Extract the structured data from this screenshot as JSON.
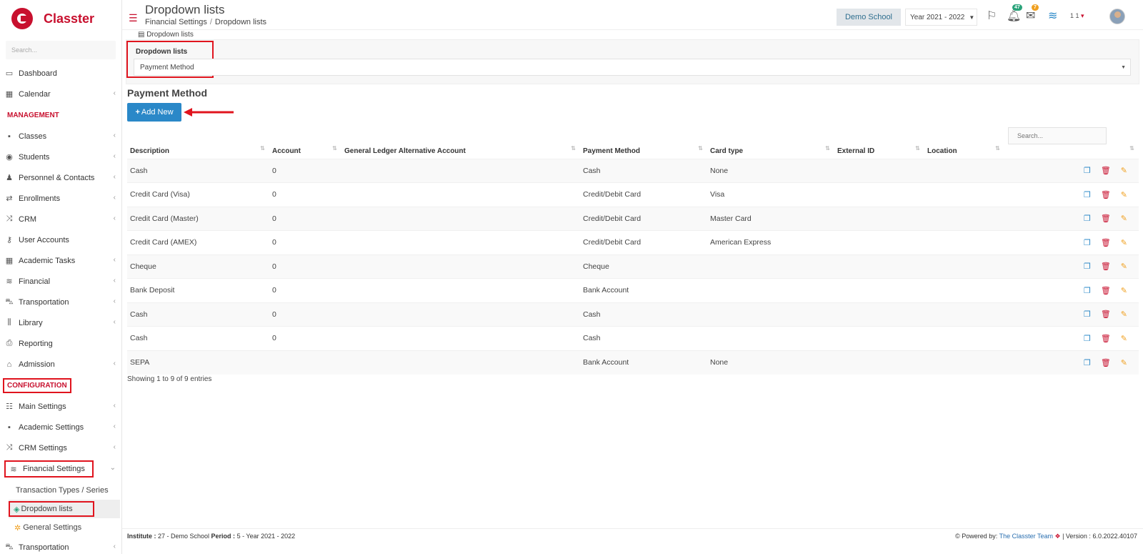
{
  "app": {
    "brand": "Classter",
    "brand_color": "#c8102e",
    "accent": "#2a88c8"
  },
  "sidebar": {
    "search_placeholder": "Search...",
    "items_top": [
      {
        "label": "Dashboard",
        "icon": "laptop-icon"
      },
      {
        "label": "Calendar",
        "icon": "calendar-icon"
      }
    ],
    "management_header": "MANAGEMENT",
    "management": [
      {
        "label": "Classes",
        "icon": "classes-icon"
      },
      {
        "label": "Students",
        "icon": "students-icon"
      },
      {
        "label": "Personnel & Contacts",
        "icon": "person-icon"
      },
      {
        "label": "Enrollments",
        "icon": "exchange-icon"
      },
      {
        "label": "CRM",
        "icon": "shuffle-icon"
      },
      {
        "label": "User Accounts",
        "icon": "key-icon"
      },
      {
        "label": "Academic Tasks",
        "icon": "tasks-icon"
      },
      {
        "label": "Financial",
        "icon": "coins-icon"
      },
      {
        "label": "Transportation",
        "icon": "bus-icon"
      },
      {
        "label": "Library",
        "icon": "books-icon"
      },
      {
        "label": "Reporting",
        "icon": "print-icon"
      },
      {
        "label": "Admission",
        "icon": "institution-icon"
      }
    ],
    "configuration_header": "CONFIGURATION",
    "configuration": [
      {
        "label": "Main Settings",
        "icon": "sliders-icon"
      },
      {
        "label": "Academic Settings",
        "icon": "classes-icon"
      },
      {
        "label": "CRM Settings",
        "icon": "shuffle-icon"
      }
    ],
    "financial_settings": "Financial Settings",
    "sub": {
      "transaction": "Transaction Types / Series",
      "dropdown": "Dropdown lists",
      "general": "General Settings"
    },
    "transport_bottom": "Transportation"
  },
  "header": {
    "title": "Dropdown lists",
    "breadcrumb": [
      "Financial Settings",
      "Dropdown lists"
    ],
    "school": "Demo School",
    "year": "Year 2021 - 2022",
    "notif_count": "47",
    "mail_count": "7",
    "user_short": "1 1"
  },
  "main": {
    "tab_label": "Dropdown lists",
    "panel_label": "Dropdown lists",
    "selected_list": "Payment Method",
    "section_title": "Payment Method",
    "add_label": "Add New",
    "search_placeholder": "Search...",
    "columns": [
      "Description",
      "Account",
      "General Ledger Alternative Account",
      "Payment Method",
      "Card type",
      "External ID",
      "Location"
    ],
    "rows": [
      [
        "Cash",
        "0",
        "",
        "Cash",
        "None",
        "",
        ""
      ],
      [
        "Credit Card (Visa)",
        "0",
        "",
        "Credit/Debit Card",
        "Visa",
        "",
        ""
      ],
      [
        "Credit Card (Master)",
        "0",
        "",
        "Credit/Debit Card",
        "Master Card",
        "",
        ""
      ],
      [
        "Credit Card (AMEX)",
        "0",
        "",
        "Credit/Debit Card",
        "American Express",
        "",
        ""
      ],
      [
        "Cheque",
        "0",
        "",
        "Cheque",
        "",
        "",
        ""
      ],
      [
        "Bank Deposit",
        "0",
        "",
        "Bank Account",
        "",
        "",
        ""
      ],
      [
        "Cash",
        "0",
        "",
        "Cash",
        "",
        "",
        ""
      ],
      [
        "Cash",
        "0",
        "",
        "Cash",
        "",
        "",
        ""
      ],
      [
        "SEPA",
        "",
        "",
        "Bank Account",
        "None",
        "",
        ""
      ]
    ],
    "showing": "Showing 1 to 9 of 9 entries"
  },
  "footer": {
    "institute_label": "Institute :",
    "institute_value": " 27 - Demo School ",
    "period_label": "Period :",
    "period_value": " 5 - Year 2021 - 2022",
    "powered": "Powered by: ",
    "team": "The Classter Team",
    "version": " | Version : 6.0.2022.40107"
  }
}
